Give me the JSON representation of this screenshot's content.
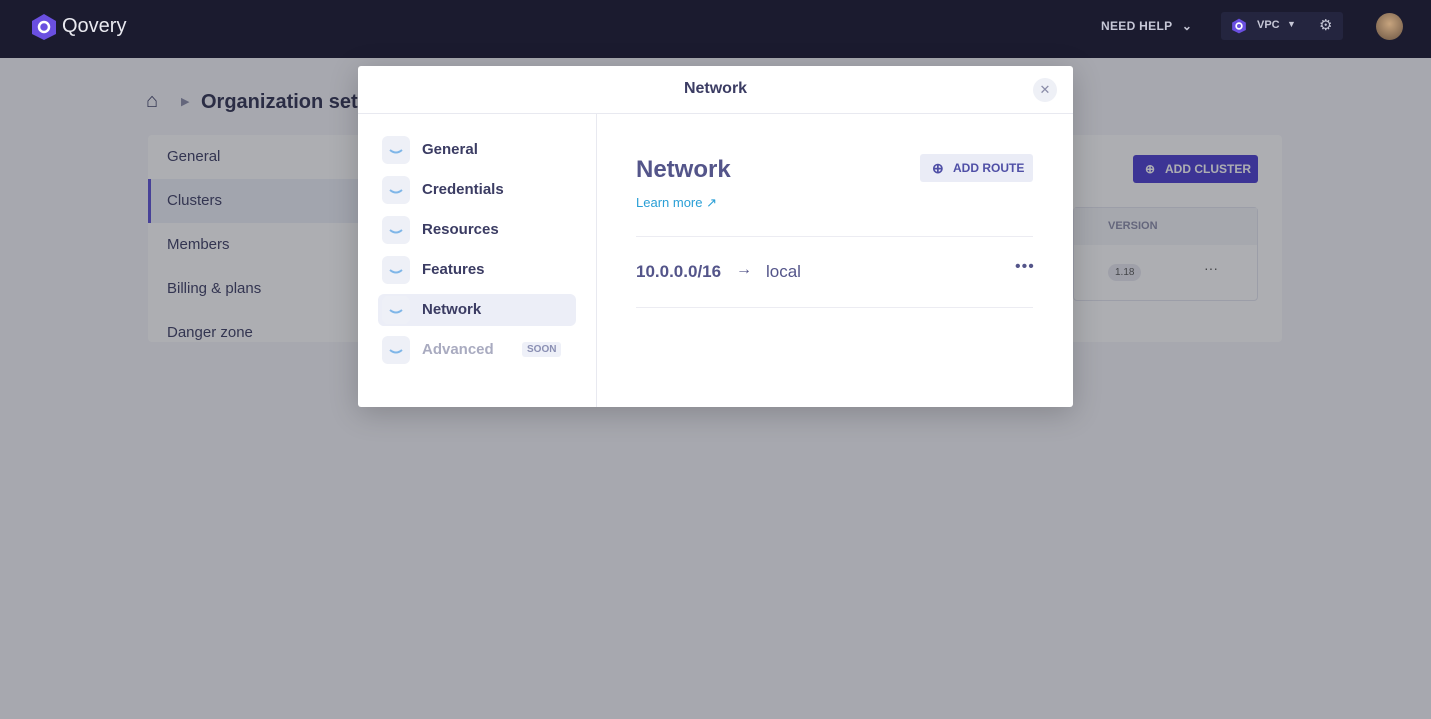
{
  "topbar": {
    "brand": "Qovery",
    "help": "NEED HELP",
    "env": "VPC"
  },
  "breadcrumb": {
    "title": "Organization settings"
  },
  "settings_menu": [
    "General",
    "Clusters",
    "Members",
    "Billing & plans",
    "Danger zone"
  ],
  "clusters": {
    "add_button": "ADD CLUSTER",
    "col_version": "VERSION",
    "version": "1.18"
  },
  "modal": {
    "title": "Network",
    "menu": [
      {
        "label": "General"
      },
      {
        "label": "Credentials"
      },
      {
        "label": "Resources"
      },
      {
        "label": "Features"
      },
      {
        "label": "Network",
        "active": true
      },
      {
        "label": "Advanced",
        "disabled": true,
        "badge": "SOON"
      }
    ],
    "heading": "Network",
    "learn_more": "Learn more",
    "add_route": "ADD ROUTE",
    "routes": [
      {
        "destination": "10.0.0.0/16",
        "target": "local"
      }
    ]
  },
  "colors": {
    "accent": "#4a3bd0",
    "topbar": "#1b1b2f",
    "link": "#2a9fd6"
  }
}
